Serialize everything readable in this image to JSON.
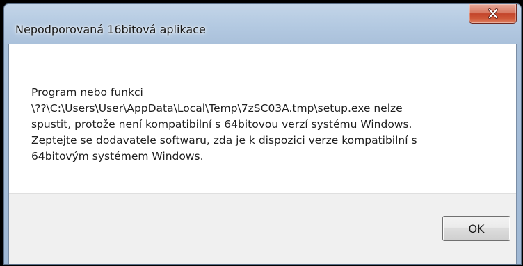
{
  "window": {
    "title": "Nepodporovaná 16bitová aplikace"
  },
  "controls": {
    "close_icon": "close-x-icon"
  },
  "message": {
    "lines": [
      "Program nebo funkci",
      "\\??\\C:\\Users\\User\\AppData\\Local\\Temp\\7zSC03A.tmp\\setup.exe nelze",
      "spustit, protože není kompatibilní s 64bitovou verzí systému Windows.",
      "Zeptejte se dodavatele softwaru, zda je k dispozici verze kompatibilní s",
      "64bitovým systémem Windows."
    ]
  },
  "buttons": {
    "ok_label": "OK"
  },
  "colors": {
    "close_button": "#c3452b",
    "frame": "#b3c9e1",
    "footer": "#f0f0f0"
  }
}
